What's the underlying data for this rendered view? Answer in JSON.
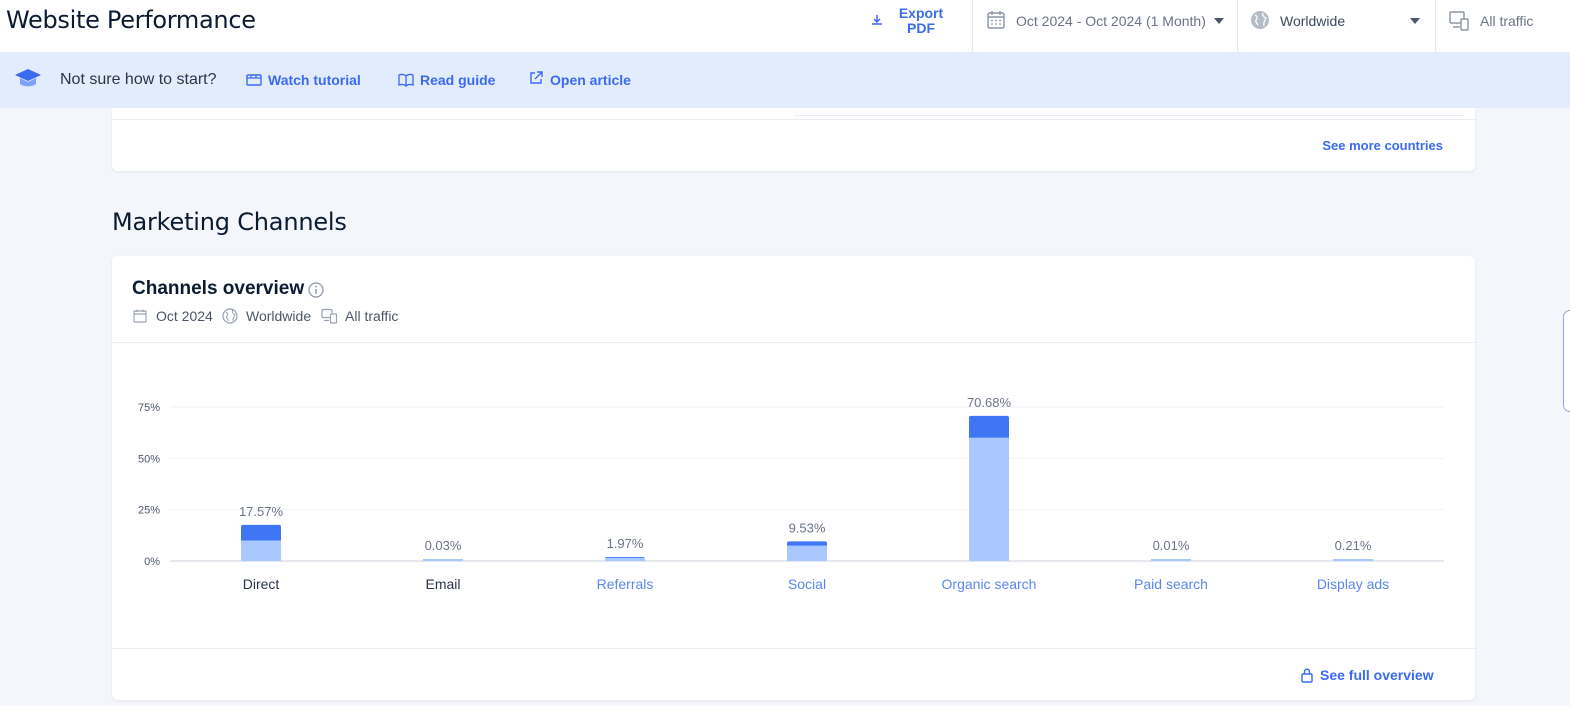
{
  "header": {
    "title": "Website Performance",
    "export_label": "Export PDF",
    "date_range": "Oct 2024 - Oct 2024 (1 Month)",
    "geo": "Worldwide",
    "traffic": "All traffic"
  },
  "helpbar": {
    "question": "Not sure how to start?",
    "watch": "Watch tutorial",
    "read": "Read guide",
    "open": "Open article"
  },
  "countries_card": {
    "see_more": "See more countries"
  },
  "section": {
    "title": "Marketing Channels"
  },
  "channels_card": {
    "title": "Channels overview",
    "date": "Oct 2024",
    "geo": "Worldwide",
    "traffic": "All traffic",
    "see_full": "See full overview"
  },
  "colors": {
    "accent": "#3a6bf0",
    "bar_dark": "#3f76f6",
    "bar_light": "#a9c8fd",
    "label_link": "#5c86ee"
  },
  "chart_data": {
    "type": "bar",
    "categories": [
      "Direct",
      "Email",
      "Referrals",
      "Social",
      "Organic search",
      "Paid search",
      "Display ads"
    ],
    "values": [
      17.57,
      0.03,
      1.97,
      9.53,
      70.68,
      0.01,
      0.21
    ],
    "value_labels": [
      "17.57%",
      "0.03%",
      "1.97%",
      "9.53%",
      "70.68%",
      "0.01%",
      "0.21%"
    ],
    "light_segment": [
      10,
      0.03,
      1.5,
      7.5,
      60,
      0.01,
      0.21
    ],
    "category_is_link": [
      false,
      false,
      true,
      true,
      true,
      true,
      true
    ],
    "yticks": [
      "0%",
      "25%",
      "50%",
      "75%"
    ],
    "ytick_values": [
      0,
      25,
      50,
      75
    ],
    "ylim": [
      0,
      75
    ],
    "grid": true
  }
}
